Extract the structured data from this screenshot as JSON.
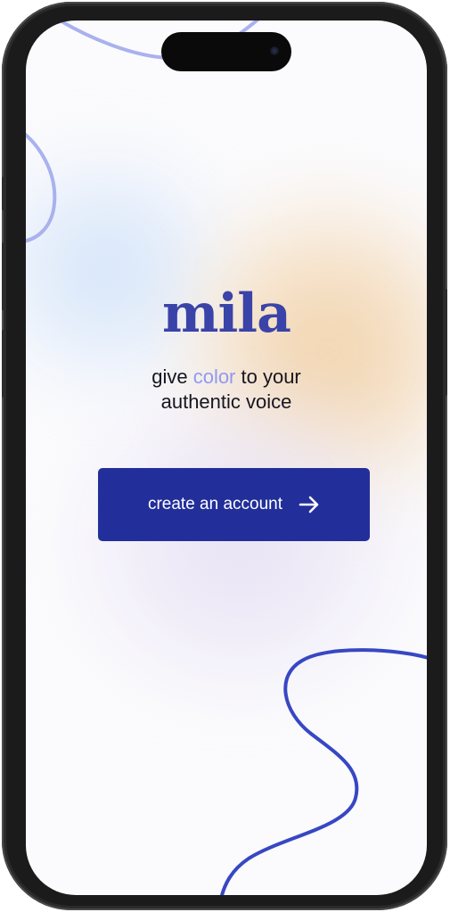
{
  "app": {
    "brand": "mila"
  },
  "welcome": {
    "tagline_pre": "give ",
    "tagline_accent": "color",
    "tagline_post": " to your",
    "tagline_line2": "authentic voice"
  },
  "cta": {
    "label": "create an account",
    "icon": "arrow-right-icon"
  },
  "colors": {
    "brand": "#3a43a8",
    "accent": "#8f9af0",
    "button": "#222f9a",
    "decorative_line_light": "#a9b1ee",
    "decorative_line_dark": "#3747c4"
  }
}
